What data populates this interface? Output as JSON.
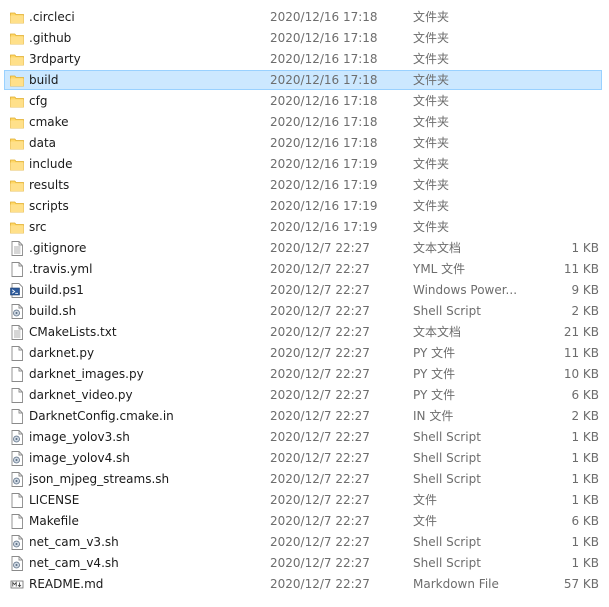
{
  "files": [
    {
      "name": ".circleci",
      "date": "2020/12/16 17:18",
      "type": "文件夹",
      "size": "",
      "icon": "folder-icon"
    },
    {
      "name": ".github",
      "date": "2020/12/16 17:18",
      "type": "文件夹",
      "size": "",
      "icon": "folder-icon"
    },
    {
      "name": "3rdparty",
      "date": "2020/12/16 17:18",
      "type": "文件夹",
      "size": "",
      "icon": "folder-icon"
    },
    {
      "name": "build",
      "date": "2020/12/16 17:18",
      "type": "文件夹",
      "size": "",
      "icon": "folder-icon",
      "selected": true
    },
    {
      "name": "cfg",
      "date": "2020/12/16 17:18",
      "type": "文件夹",
      "size": "",
      "icon": "folder-icon"
    },
    {
      "name": "cmake",
      "date": "2020/12/16 17:18",
      "type": "文件夹",
      "size": "",
      "icon": "folder-icon"
    },
    {
      "name": "data",
      "date": "2020/12/16 17:18",
      "type": "文件夹",
      "size": "",
      "icon": "folder-icon"
    },
    {
      "name": "include",
      "date": "2020/12/16 17:19",
      "type": "文件夹",
      "size": "",
      "icon": "folder-icon"
    },
    {
      "name": "results",
      "date": "2020/12/16 17:19",
      "type": "文件夹",
      "size": "",
      "icon": "folder-icon"
    },
    {
      "name": "scripts",
      "date": "2020/12/16 17:19",
      "type": "文件夹",
      "size": "",
      "icon": "folder-icon"
    },
    {
      "name": "src",
      "date": "2020/12/16 17:19",
      "type": "文件夹",
      "size": "",
      "icon": "folder-icon"
    },
    {
      "name": ".gitignore",
      "date": "2020/12/7 22:27",
      "type": "文本文档",
      "size": "1 KB",
      "icon": "text-file-icon"
    },
    {
      "name": ".travis.yml",
      "date": "2020/12/7 22:27",
      "type": "YML 文件",
      "size": "11 KB",
      "icon": "file-icon"
    },
    {
      "name": "build.ps1",
      "date": "2020/12/7 22:27",
      "type": "Windows Power...",
      "size": "9 KB",
      "icon": "powershell-icon"
    },
    {
      "name": "build.sh",
      "date": "2020/12/7 22:27",
      "type": "Shell Script",
      "size": "2 KB",
      "icon": "script-icon"
    },
    {
      "name": "CMakeLists.txt",
      "date": "2020/12/7 22:27",
      "type": "文本文档",
      "size": "21 KB",
      "icon": "text-file-icon"
    },
    {
      "name": "darknet.py",
      "date": "2020/12/7 22:27",
      "type": "PY 文件",
      "size": "11 KB",
      "icon": "file-icon"
    },
    {
      "name": "darknet_images.py",
      "date": "2020/12/7 22:27",
      "type": "PY 文件",
      "size": "10 KB",
      "icon": "file-icon"
    },
    {
      "name": "darknet_video.py",
      "date": "2020/12/7 22:27",
      "type": "PY 文件",
      "size": "6 KB",
      "icon": "file-icon"
    },
    {
      "name": "DarknetConfig.cmake.in",
      "date": "2020/12/7 22:27",
      "type": "IN 文件",
      "size": "2 KB",
      "icon": "file-icon"
    },
    {
      "name": "image_yolov3.sh",
      "date": "2020/12/7 22:27",
      "type": "Shell Script",
      "size": "1 KB",
      "icon": "script-icon"
    },
    {
      "name": "image_yolov4.sh",
      "date": "2020/12/7 22:27",
      "type": "Shell Script",
      "size": "1 KB",
      "icon": "script-icon"
    },
    {
      "name": "json_mjpeg_streams.sh",
      "date": "2020/12/7 22:27",
      "type": "Shell Script",
      "size": "1 KB",
      "icon": "script-icon"
    },
    {
      "name": "LICENSE",
      "date": "2020/12/7 22:27",
      "type": "文件",
      "size": "1 KB",
      "icon": "file-icon"
    },
    {
      "name": "Makefile",
      "date": "2020/12/7 22:27",
      "type": "文件",
      "size": "6 KB",
      "icon": "file-icon"
    },
    {
      "name": "net_cam_v3.sh",
      "date": "2020/12/7 22:27",
      "type": "Shell Script",
      "size": "1 KB",
      "icon": "script-icon"
    },
    {
      "name": "net_cam_v4.sh",
      "date": "2020/12/7 22:27",
      "type": "Shell Script",
      "size": "1 KB",
      "icon": "script-icon"
    },
    {
      "name": "README.md",
      "date": "2020/12/7 22:27",
      "type": "Markdown File",
      "size": "57 KB",
      "icon": "markdown-icon"
    }
  ]
}
